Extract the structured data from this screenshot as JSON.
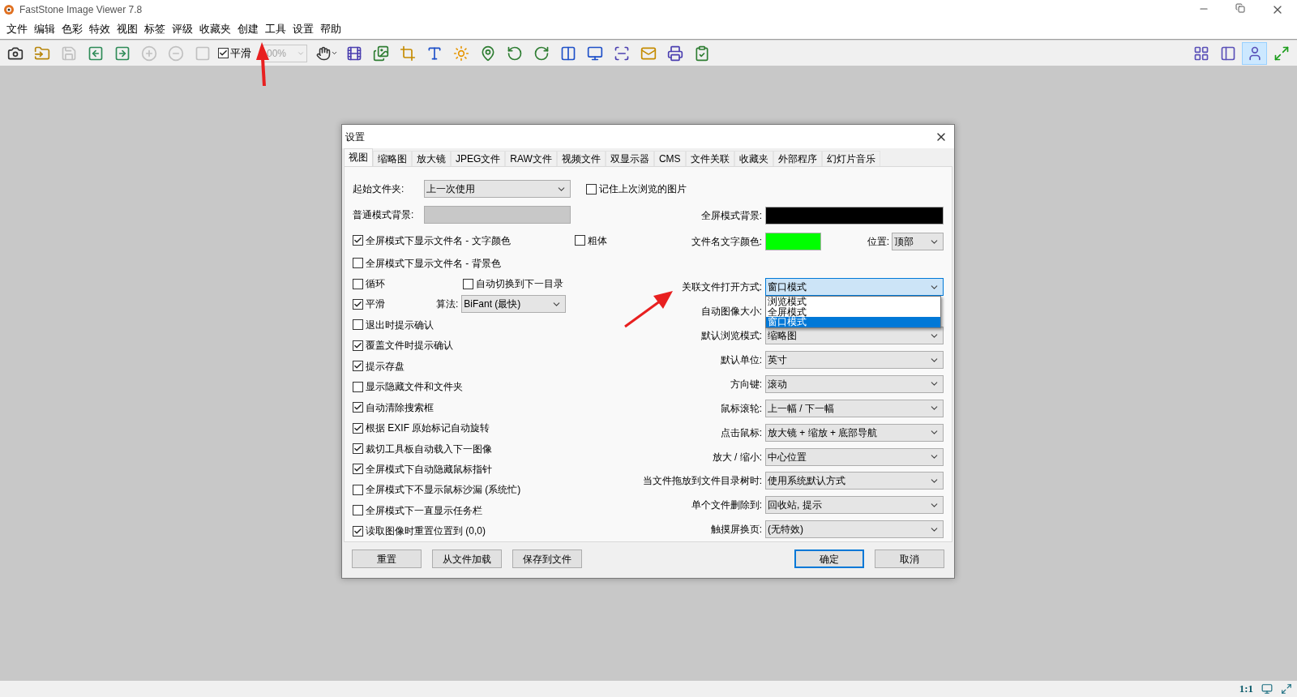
{
  "window": {
    "title": "FastStone Image Viewer 7.8"
  },
  "menu": [
    "文件",
    "编辑",
    "色彩",
    "特效",
    "视图",
    "标签",
    "评级",
    "收藏夹",
    "创建",
    "工具",
    "设置",
    "帮助"
  ],
  "toolbar": {
    "buttons": [
      {
        "disabled": false
      },
      {
        "disabled": false
      },
      {
        "disabled": true
      },
      {
        "disabled": false
      },
      {
        "disabled": false
      },
      {
        "disabled": true
      },
      {
        "disabled": true
      },
      {
        "disabled": true
      }
    ],
    "smooth": {
      "label": "平滑",
      "checked": true
    },
    "zoom": {
      "value": "00%"
    },
    "view_modes": [
      {
        "selected": false
      },
      {
        "selected": false
      },
      {
        "selected": true
      },
      {
        "selected": false
      }
    ]
  },
  "dialog": {
    "title": "设置",
    "tabs": [
      {
        "label": "视图",
        "selected": true
      },
      {
        "label": "缩略图",
        "selected": false
      },
      {
        "label": "放大镜",
        "selected": false
      },
      {
        "label": "JPEG文件",
        "selected": false
      },
      {
        "label": "RAW文件",
        "selected": false
      },
      {
        "label": "视频文件",
        "selected": false
      },
      {
        "label": "双显示器",
        "selected": false
      },
      {
        "label": "CMS",
        "selected": false
      },
      {
        "label": "文件关联",
        "selected": false
      },
      {
        "label": "收藏夹",
        "selected": false
      },
      {
        "label": "外部程序",
        "selected": false
      },
      {
        "label": "幻灯片音乐",
        "selected": false
      }
    ],
    "left": [
      {
        "kind": "select",
        "label": "起始文件夹:",
        "value": "上一次使用",
        "extra": {
          "label": "记住上次浏览的图片",
          "checked": false
        }
      },
      {
        "kind": "color",
        "label": "普通模式背景:",
        "color": "#c8c8c8"
      },
      {
        "kind": "checkbox",
        "label": "全屏模式下显示文件名 - 文字颜色",
        "checked": true,
        "extra": {
          "label": "粗体",
          "checked": false
        }
      },
      {
        "kind": "checkbox",
        "label": "全屏模式下显示文件名 - 背景色",
        "checked": false
      },
      {
        "kind": "checkbox",
        "label": "循环",
        "checked": false,
        "extra": {
          "label": "自动切换到下一目录",
          "checked": false
        }
      },
      {
        "kind": "checkbox",
        "label": "平滑",
        "checked": true,
        "algorithm": {
          "label": "算法:",
          "value": "BiFant (最快)"
        }
      },
      {
        "kind": "checkbox",
        "label": "退出时提示确认",
        "checked": false
      },
      {
        "kind": "checkbox",
        "label": "覆盖文件时提示确认",
        "checked": true
      },
      {
        "kind": "checkbox",
        "label": "提示存盘",
        "checked": true
      },
      {
        "kind": "checkbox",
        "label": "显示隐藏文件和文件夹",
        "checked": false
      },
      {
        "kind": "checkbox",
        "label": "自动清除搜索框",
        "checked": true
      },
      {
        "kind": "checkbox",
        "label": "根据 EXIF 原始标记自动旋转",
        "checked": true
      },
      {
        "kind": "checkbox",
        "label": "裁切工具板自动载入下一图像",
        "checked": true
      },
      {
        "kind": "checkbox",
        "label": "全屏模式下自动隐藏鼠标指针",
        "checked": true
      },
      {
        "kind": "checkbox",
        "label": "全屏模式下不显示鼠标沙漏 (系统忙)",
        "checked": false
      },
      {
        "kind": "checkbox",
        "label": "全屏模式下一直显示任务栏",
        "checked": false
      },
      {
        "kind": "checkbox",
        "label": "读取图像时重置位置到 (0,0)",
        "checked": true
      }
    ],
    "right": [
      {
        "kind": "color",
        "label": "全屏模式背景:",
        "color": "#000000"
      },
      {
        "kind": "color",
        "label": "文件名文字颜色:",
        "color": "#00ff00",
        "position": {
          "label": "位置:",
          "value": "顶部"
        }
      },
      {
        "kind": "select",
        "label": "关联文件打开方式:",
        "value": "窗口模式",
        "expanded": true,
        "options": [
          {
            "label": "浏览模式",
            "selected": false
          },
          {
            "label": "全屏模式",
            "selected": false
          },
          {
            "label": "窗口模式",
            "selected": true
          }
        ]
      },
      {
        "kind": "select",
        "label": "自动图像大小:",
        "expanded": false
      },
      {
        "kind": "select",
        "label": "默认浏览模式:",
        "value": "缩略图",
        "expanded": false
      },
      {
        "kind": "select",
        "label": "默认单位:",
        "value": "英寸",
        "expanded": false
      },
      {
        "kind": "select",
        "label": "方向键:",
        "value": "滚动",
        "expanded": false
      },
      {
        "kind": "select",
        "label": "鼠标滚轮:",
        "value": "上一幅 / 下一幅",
        "expanded": false
      },
      {
        "kind": "select",
        "label": "点击鼠标:",
        "value": "放大镜 + 缩放 + 底部导航",
        "expanded": false
      },
      {
        "kind": "select",
        "label": "放大 / 缩小:",
        "value": "中心位置",
        "expanded": false
      },
      {
        "kind": "select",
        "label": "当文件拖放到文件目录树时:",
        "value": "使用系统默认方式",
        "expanded": false
      },
      {
        "kind": "select",
        "label": "单个文件删除到:",
        "value": "回收站, 提示",
        "expanded": false
      },
      {
        "kind": "select",
        "label": "触摸屏换页:",
        "value": "(无特效)",
        "expanded": false
      }
    ],
    "left_buttons": [
      "重置",
      "从文件加载",
      "保存到文件"
    ],
    "right_buttons": [
      {
        "label": "确定",
        "default": true
      },
      {
        "label": "取消",
        "default": false
      }
    ]
  },
  "status_bar": {
    "zoom_label": "1:1"
  }
}
